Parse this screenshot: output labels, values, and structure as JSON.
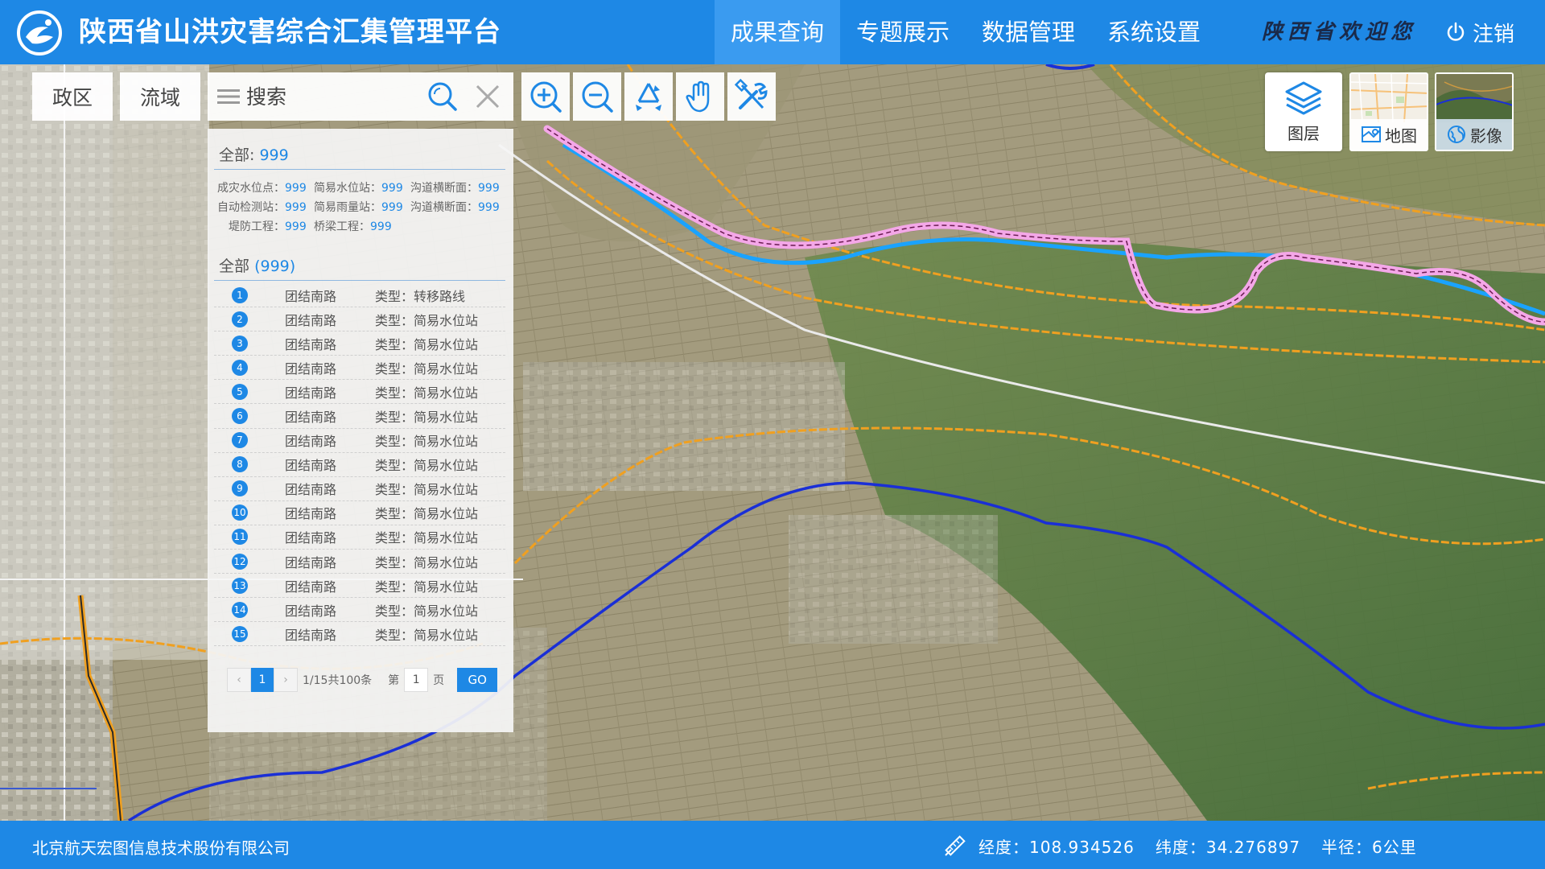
{
  "header": {
    "title": "陕西省山洪灾害综合汇集管理平台",
    "nav": [
      {
        "label": "成果查询",
        "active": true
      },
      {
        "label": "专题展示",
        "active": false
      },
      {
        "label": "数据管理",
        "active": false
      },
      {
        "label": "系统设置",
        "active": false
      }
    ],
    "welcome": "陕西省欢迎您",
    "logout": "注销"
  },
  "toolbar": {
    "tab_region": "政区",
    "tab_basin": "流域",
    "search_placeholder": "搜索",
    "tools": [
      "zoom-in-icon",
      "zoom-out-icon",
      "recycle-icon",
      "pan-hand-icon",
      "tools-icon"
    ]
  },
  "panel": {
    "summary_label": "全部:",
    "summary_count": "999",
    "stats": [
      [
        {
          "label": "成灾水位点：",
          "value": "999"
        },
        {
          "label": "简易水位站：",
          "value": "999"
        },
        {
          "label": "沟道横断面：",
          "value": "999"
        }
      ],
      [
        {
          "label": "自动检测站：",
          "value": "999"
        },
        {
          "label": "简易雨量站：",
          "value": "999"
        },
        {
          "label": "沟道横断面：",
          "value": "999"
        }
      ],
      [
        {
          "label": "堤防工程：",
          "value": "999"
        },
        {
          "label": "桥梁工程：",
          "value": "999"
        }
      ]
    ],
    "list_label": "全部",
    "list_count": "(999)",
    "rows": [
      {
        "idx": "1",
        "name": "团结南路",
        "type": "类型：转移路线"
      },
      {
        "idx": "2",
        "name": "团结南路",
        "type": "类型：简易水位站"
      },
      {
        "idx": "3",
        "name": "团结南路",
        "type": "类型：简易水位站"
      },
      {
        "idx": "4",
        "name": "团结南路",
        "type": "类型：简易水位站"
      },
      {
        "idx": "5",
        "name": "团结南路",
        "type": "类型：简易水位站"
      },
      {
        "idx": "6",
        "name": "团结南路",
        "type": "类型：简易水位站"
      },
      {
        "idx": "7",
        "name": "团结南路",
        "type": "类型：简易水位站"
      },
      {
        "idx": "8",
        "name": "团结南路",
        "type": "类型：简易水位站"
      },
      {
        "idx": "9",
        "name": "团结南路",
        "type": "类型：简易水位站"
      },
      {
        "idx": "10",
        "name": "团结南路",
        "type": "类型：简易水位站"
      },
      {
        "idx": "11",
        "name": "团结南路",
        "type": "类型：简易水位站"
      },
      {
        "idx": "12",
        "name": "团结南路",
        "type": "类型：简易水位站"
      },
      {
        "idx": "13",
        "name": "团结南路",
        "type": "类型：简易水位站"
      },
      {
        "idx": "14",
        "name": "团结南路",
        "type": "类型：简易水位站"
      },
      {
        "idx": "15",
        "name": "团结南路",
        "type": "类型：简易水位站"
      }
    ],
    "pager": {
      "prev": "‹",
      "current": "1",
      "next": "›",
      "info": "1/15共100条",
      "goto_prefix": "第",
      "goto_value": "1",
      "goto_suffix": "页",
      "go": "GO"
    }
  },
  "layers": {
    "layer_label": "图层",
    "map_label": "地图",
    "image_label": "影像"
  },
  "footer": {
    "company": "北京航天宏图信息技术股份有限公司",
    "longitude": "经度：108.934526",
    "latitude": "纬度：34.276897",
    "radius": "半径：6公里"
  },
  "colors": {
    "primary": "#1e88e5",
    "river": "#1a2fd6",
    "road": "#f0a020",
    "route_highlight": "#f4a7e8"
  }
}
